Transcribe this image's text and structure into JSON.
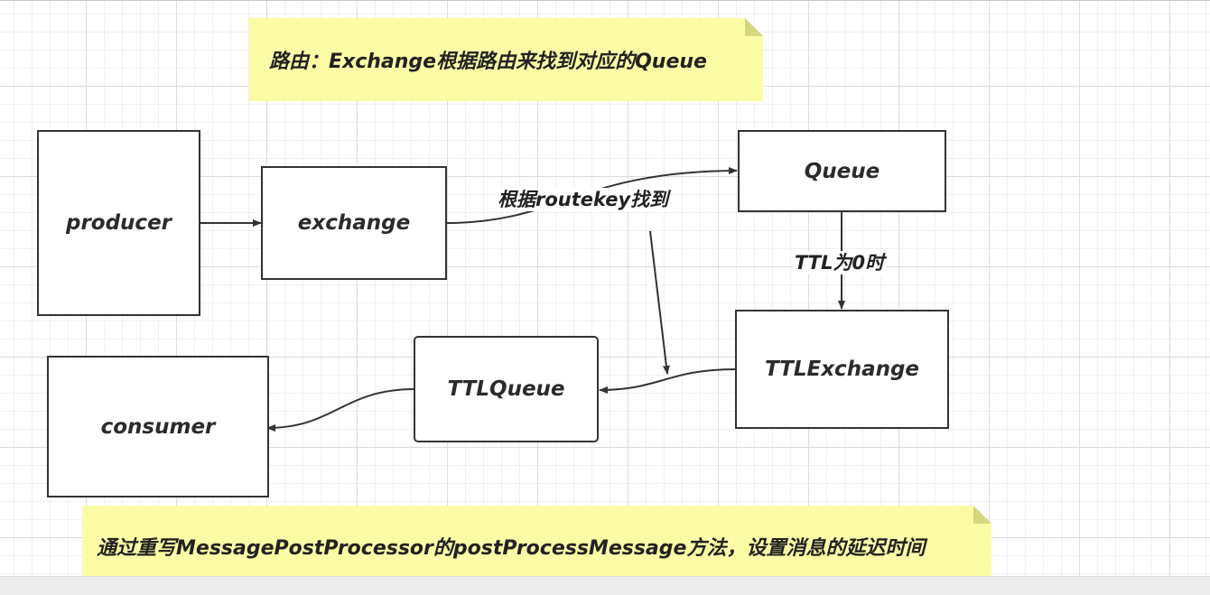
{
  "notes": {
    "routing": "路由：Exchange根据路由来找到对应的Queue",
    "delay": "通过重写MessagePostProcessor的postProcessMessage方法，设置消息的延迟时间"
  },
  "nodes": {
    "producer": "producer",
    "exchange": "exchange",
    "queue": "Queue",
    "ttl_exchange": "TTLExchange",
    "ttl_queue": "TTLQueue",
    "consumer": "consumer"
  },
  "edge_labels": {
    "exchange_to_queue": "根据routekey找到",
    "queue_to_ttl_exchange": "TTL为0时"
  },
  "colors": {
    "note_fill": "#fcfca6",
    "stroke": "#333333"
  }
}
